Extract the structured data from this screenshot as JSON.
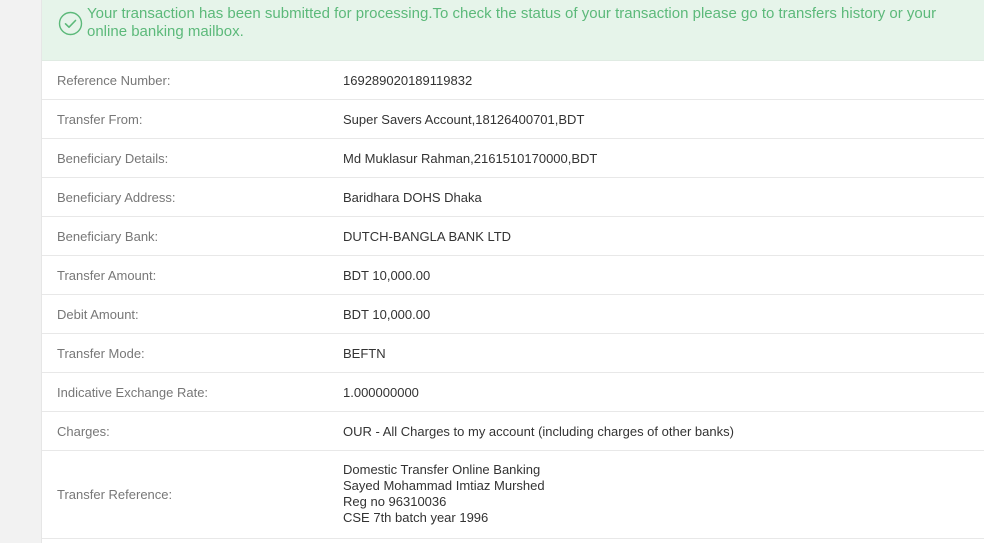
{
  "alert": {
    "icon": "check-circle-icon",
    "message": "Your transaction has been submitted for processing.To check the status of your transaction please go to transfers history or your online banking mailbox.",
    "color": "#5cb97a",
    "background": "#e6f4ea"
  },
  "details": {
    "reference_number": {
      "label": "Reference Number:",
      "value": "169289020189119832"
    },
    "transfer_from": {
      "label": "Transfer From:",
      "value": "Super Savers Account,18126400701,BDT"
    },
    "beneficiary_details": {
      "label": "Beneficiary Details:",
      "value": "Md Muklasur Rahman,2161510170000,BDT"
    },
    "beneficiary_address": {
      "label": "Beneficiary Address:",
      "value": "Baridhara DOHS Dhaka"
    },
    "beneficiary_bank": {
      "label": "Beneficiary Bank:",
      "value": "DUTCH-BANGLA BANK LTD"
    },
    "transfer_amount": {
      "label": "Transfer Amount:",
      "value": "BDT 10,000.00"
    },
    "debit_amount": {
      "label": "Debit Amount:",
      "value": "BDT 10,000.00"
    },
    "transfer_mode": {
      "label": "Transfer Mode:",
      "value": "BEFTN"
    },
    "exchange_rate": {
      "label": "Indicative Exchange Rate:",
      "value": "1.000000000"
    },
    "charges": {
      "label": "Charges:",
      "value": "OUR - All Charges to my account (including charges of other banks)"
    },
    "transfer_reference": {
      "label": "Transfer Reference:",
      "lines": [
        "Domestic Transfer Online Banking",
        "Sayed Mohammad Imtiaz Murshed",
        "Reg no 96310036",
        "CSE 7th batch year 1996"
      ]
    }
  }
}
